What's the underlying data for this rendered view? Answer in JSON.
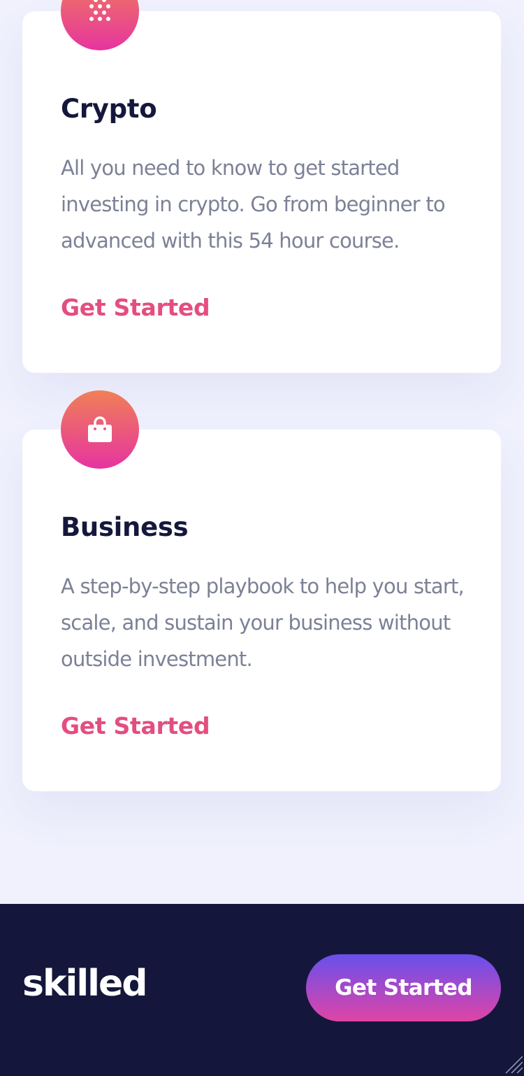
{
  "cards": [
    {
      "icon": "crypto-dots-icon",
      "title": "Crypto",
      "description": "All you need to know to get started investing in crypto. Go from beginner to advanced with this 54 hour course.",
      "link": "Get Started"
    },
    {
      "icon": "shopping-bag-icon",
      "title": "Business",
      "description": "A step-by-step playbook to help you start, scale, and sustain your business without outside investment.",
      "link": "Get Started"
    }
  ],
  "footer": {
    "logo": "skilled",
    "cta_label": "Get Started"
  },
  "colors": {
    "page_background": "#f0f1fd",
    "card_background": "#ffffff",
    "heading": "#15183c",
    "body_text": "#7c8196",
    "accent_link": "#e44e7f",
    "footer_background": "#14173b",
    "icon_gradient": [
      "#f08057",
      "#e6349f"
    ],
    "button_gradient": [
      "#6850ec",
      "#e044a6"
    ]
  }
}
